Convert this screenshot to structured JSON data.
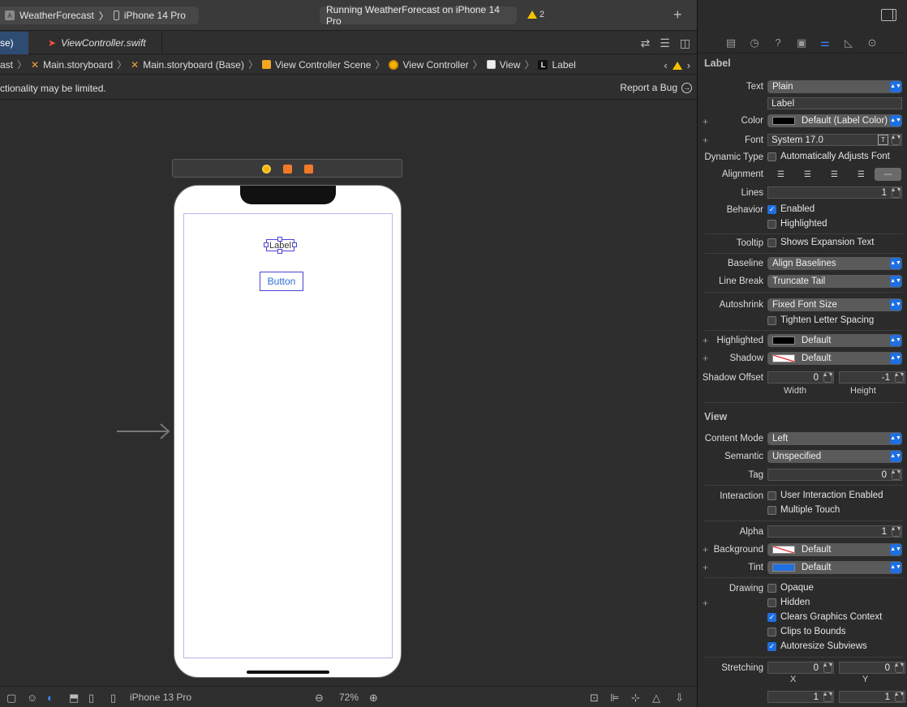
{
  "toolbar": {
    "scheme": "WeatherForecast",
    "device": "iPhone 14 Pro",
    "status": "Running WeatherForecast on iPhone 14 Pro",
    "warning_count": "2",
    "add_label": "+"
  },
  "tabs": {
    "active_partial": "se)",
    "file": "ViewController.swift"
  },
  "breadcrumb": {
    "items": [
      "ast",
      "Main.storyboard",
      "Main.storyboard (Base)",
      "View Controller Scene",
      "View Controller",
      "View",
      "Label"
    ]
  },
  "notice": {
    "message": "ctionality may be limited.",
    "report": "Report a Bug"
  },
  "canvas": {
    "label_text": "Label",
    "button_text": "Button"
  },
  "statusbar": {
    "device": "iPhone 13 Pro",
    "zoom": "72%"
  },
  "inspector": {
    "label_section": "Label",
    "text_label": "Text",
    "text_value": "Plain",
    "text_content": "Label",
    "color_label": "Color",
    "color_value": "Default (Label Color)",
    "font_label": "Font",
    "font_value": "System 17.0",
    "dynamic_type_label": "Dynamic Type",
    "dynamic_type_value": "Automatically Adjusts Font",
    "alignment_label": "Alignment",
    "lines_label": "Lines",
    "lines_value": "1",
    "behavior_label": "Behavior",
    "enabled": "Enabled",
    "highlighted": "Highlighted",
    "tooltip_label": "Tooltip",
    "tooltip_value": "Shows Expansion Text",
    "baseline_label": "Baseline",
    "baseline_value": "Align Baselines",
    "linebreak_label": "Line Break",
    "linebreak_value": "Truncate Tail",
    "autoshrink_label": "Autoshrink",
    "autoshrink_value": "Fixed Font Size",
    "tighten": "Tighten Letter Spacing",
    "highlighted_label": "Highlighted",
    "highlighted_value": "Default",
    "shadow_label": "Shadow",
    "shadow_value": "Default",
    "shadow_offset_label": "Shadow Offset",
    "shadow_width": "0",
    "shadow_height": "-1",
    "width_label": "Width",
    "height_label": "Height",
    "view_section": "View",
    "content_mode_label": "Content Mode",
    "content_mode_value": "Left",
    "semantic_label": "Semantic",
    "semantic_value": "Unspecified",
    "tag_label": "Tag",
    "tag_value": "0",
    "interaction_label": "Interaction",
    "user_interaction": "User Interaction Enabled",
    "multiple_touch": "Multiple Touch",
    "alpha_label": "Alpha",
    "alpha_value": "1",
    "background_label": "Background",
    "background_value": "Default",
    "tint_label": "Tint",
    "tint_value": "Default",
    "drawing_label": "Drawing",
    "opaque": "Opaque",
    "hidden": "Hidden",
    "clears": "Clears Graphics Context",
    "clips": "Clips to Bounds",
    "autoresize": "Autoresize Subviews",
    "stretching_label": "Stretching",
    "stretch_x": "0",
    "stretch_y": "0",
    "x_label": "X",
    "y_label": "Y",
    "stretch_w": "1",
    "stretch_h": "1"
  },
  "colors": {
    "accent": "#1f6fe0",
    "warning": "#f5c400",
    "selection": "#4a44d6"
  }
}
